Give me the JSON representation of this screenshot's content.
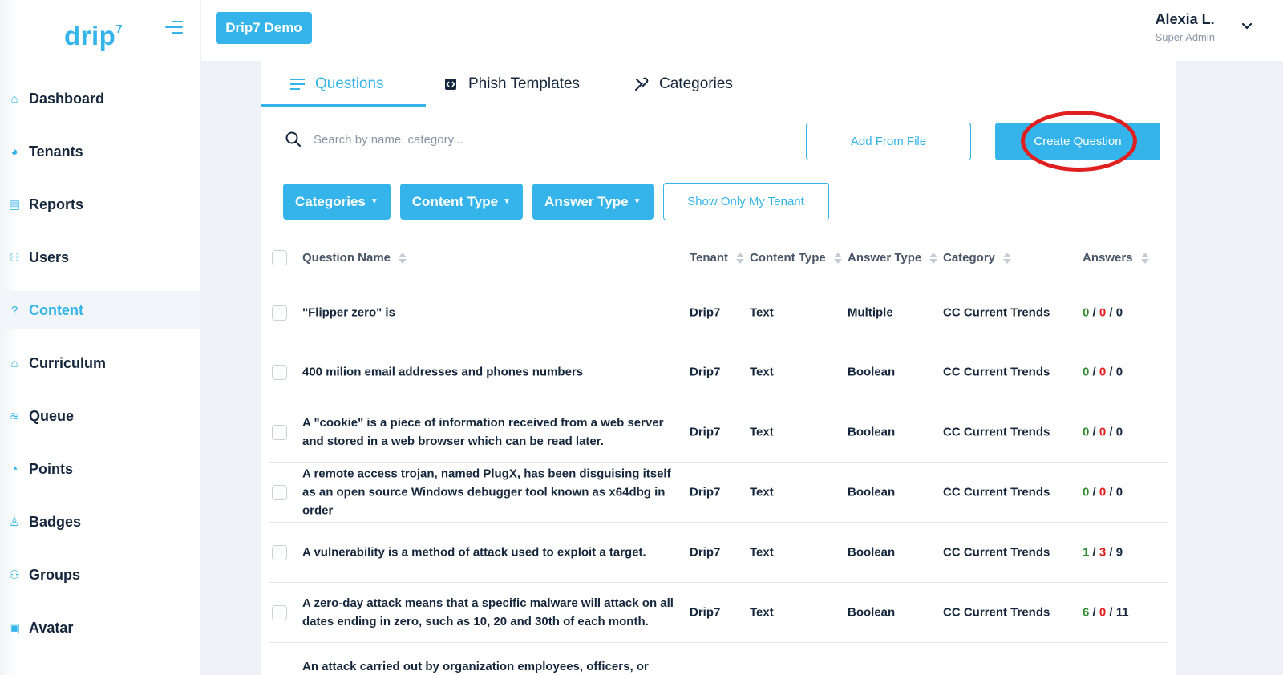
{
  "brand": {
    "name": "drip",
    "superscript": "7",
    "color": "#34b4ea"
  },
  "sidebar": {
    "items": [
      {
        "label": "Dashboard",
        "icon": "home-icon",
        "glyph": "⌂"
      },
      {
        "label": "Tenants",
        "icon": "palette-icon",
        "glyph": "◕"
      },
      {
        "label": "Reports",
        "icon": "report-icon",
        "glyph": "▤"
      },
      {
        "label": "Users",
        "icon": "users-icon",
        "glyph": "⚇"
      },
      {
        "label": "Content",
        "icon": "question-circle-icon",
        "glyph": "?"
      },
      {
        "label": "Curriculum",
        "icon": "graduation-cap-icon",
        "glyph": "⌂"
      },
      {
        "label": "Queue",
        "icon": "layers-icon",
        "glyph": "≋"
      },
      {
        "label": "Points",
        "icon": "pie-chart-icon",
        "glyph": "◔"
      },
      {
        "label": "Badges",
        "icon": "badge-icon",
        "glyph": "♙"
      },
      {
        "label": "Groups",
        "icon": "groups-icon",
        "glyph": "⚇"
      },
      {
        "label": "Avatar",
        "icon": "avatar-icon",
        "glyph": "▣"
      }
    ],
    "active_index": 4
  },
  "topbar": {
    "tenant_button": "Drip7 Demo",
    "user_name": "Alexia L.",
    "user_role": "Super Admin"
  },
  "tabs": [
    {
      "label": "Questions",
      "icon": "list-icon",
      "active": true
    },
    {
      "label": "Phish Templates",
      "icon": "code-icon",
      "active": false
    },
    {
      "label": "Categories",
      "icon": "tools-icon",
      "active": false
    }
  ],
  "search": {
    "placeholder": "Search by name, category...",
    "value": ""
  },
  "actions": {
    "add_from_file": "Add From File",
    "create_question": "Create Question"
  },
  "filters": {
    "categories": "Categories",
    "content_type": "Content Type",
    "answer_type": "Answer Type",
    "show_only_my_tenant": "Show Only My Tenant"
  },
  "table": {
    "headers": {
      "question_name": "Question Name",
      "tenant": "Tenant",
      "content_type": "Content Type",
      "answer_type": "Answer Type",
      "category": "Category",
      "answers": "Answers"
    },
    "rows": [
      {
        "name": "\"Flipper zero\" is",
        "tenant": "Drip7",
        "content_type": "Text",
        "answer_type": "Multiple",
        "category": "CC Current Trends",
        "ans_a": "0",
        "ans_b": "0",
        "ans_c": "0"
      },
      {
        "name": "400 milion email addresses and phones numbers",
        "tenant": "Drip7",
        "content_type": "Text",
        "answer_type": "Boolean",
        "category": "CC Current Trends",
        "ans_a": "0",
        "ans_b": "0",
        "ans_c": "0"
      },
      {
        "name": "A \"cookie\" is a piece of information received from a web server and stored in a web browser which can be read later.",
        "tenant": "Drip7",
        "content_type": "Text",
        "answer_type": "Boolean",
        "category": "CC Current Trends",
        "ans_a": "0",
        "ans_b": "0",
        "ans_c": "0"
      },
      {
        "name": "A remote access trojan, named PlugX, has been disguising itself as an open source Windows debugger tool known as x64dbg in order",
        "tenant": "Drip7",
        "content_type": "Text",
        "answer_type": "Boolean",
        "category": "CC Current Trends",
        "ans_a": "0",
        "ans_b": "0",
        "ans_c": "0"
      },
      {
        "name": "A vulnerability is a method of attack used to exploit a target.",
        "tenant": "Drip7",
        "content_type": "Text",
        "answer_type": "Boolean",
        "category": "CC Current Trends",
        "ans_a": "1",
        "ans_b": "3",
        "ans_c": "9"
      },
      {
        "name": "A zero-day attack means that a specific malware will attack on all dates ending in zero, such as 10, 20 and 30th of each month.",
        "tenant": "Drip7",
        "content_type": "Text",
        "answer_type": "Boolean",
        "category": "CC Current Trends",
        "ans_a": "6",
        "ans_b": "0",
        "ans_c": "11"
      },
      {
        "name": "An attack carried out by organization employees, officers, or former"
      }
    ],
    "separator": " / "
  }
}
